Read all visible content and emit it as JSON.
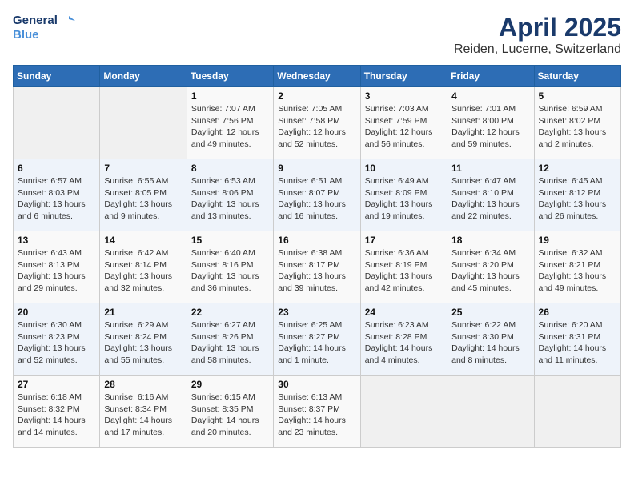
{
  "header": {
    "logo_line1": "General",
    "logo_line2": "Blue",
    "title": "April 2025",
    "subtitle": "Reiden, Lucerne, Switzerland"
  },
  "weekdays": [
    "Sunday",
    "Monday",
    "Tuesday",
    "Wednesday",
    "Thursday",
    "Friday",
    "Saturday"
  ],
  "weeks": [
    [
      {
        "day": "",
        "detail": ""
      },
      {
        "day": "",
        "detail": ""
      },
      {
        "day": "1",
        "detail": "Sunrise: 7:07 AM\nSunset: 7:56 PM\nDaylight: 12 hours and 49 minutes."
      },
      {
        "day": "2",
        "detail": "Sunrise: 7:05 AM\nSunset: 7:58 PM\nDaylight: 12 hours and 52 minutes."
      },
      {
        "day": "3",
        "detail": "Sunrise: 7:03 AM\nSunset: 7:59 PM\nDaylight: 12 hours and 56 minutes."
      },
      {
        "day": "4",
        "detail": "Sunrise: 7:01 AM\nSunset: 8:00 PM\nDaylight: 12 hours and 59 minutes."
      },
      {
        "day": "5",
        "detail": "Sunrise: 6:59 AM\nSunset: 8:02 PM\nDaylight: 13 hours and 2 minutes."
      }
    ],
    [
      {
        "day": "6",
        "detail": "Sunrise: 6:57 AM\nSunset: 8:03 PM\nDaylight: 13 hours and 6 minutes."
      },
      {
        "day": "7",
        "detail": "Sunrise: 6:55 AM\nSunset: 8:05 PM\nDaylight: 13 hours and 9 minutes."
      },
      {
        "day": "8",
        "detail": "Sunrise: 6:53 AM\nSunset: 8:06 PM\nDaylight: 13 hours and 13 minutes."
      },
      {
        "day": "9",
        "detail": "Sunrise: 6:51 AM\nSunset: 8:07 PM\nDaylight: 13 hours and 16 minutes."
      },
      {
        "day": "10",
        "detail": "Sunrise: 6:49 AM\nSunset: 8:09 PM\nDaylight: 13 hours and 19 minutes."
      },
      {
        "day": "11",
        "detail": "Sunrise: 6:47 AM\nSunset: 8:10 PM\nDaylight: 13 hours and 22 minutes."
      },
      {
        "day": "12",
        "detail": "Sunrise: 6:45 AM\nSunset: 8:12 PM\nDaylight: 13 hours and 26 minutes."
      }
    ],
    [
      {
        "day": "13",
        "detail": "Sunrise: 6:43 AM\nSunset: 8:13 PM\nDaylight: 13 hours and 29 minutes."
      },
      {
        "day": "14",
        "detail": "Sunrise: 6:42 AM\nSunset: 8:14 PM\nDaylight: 13 hours and 32 minutes."
      },
      {
        "day": "15",
        "detail": "Sunrise: 6:40 AM\nSunset: 8:16 PM\nDaylight: 13 hours and 36 minutes."
      },
      {
        "day": "16",
        "detail": "Sunrise: 6:38 AM\nSunset: 8:17 PM\nDaylight: 13 hours and 39 minutes."
      },
      {
        "day": "17",
        "detail": "Sunrise: 6:36 AM\nSunset: 8:19 PM\nDaylight: 13 hours and 42 minutes."
      },
      {
        "day": "18",
        "detail": "Sunrise: 6:34 AM\nSunset: 8:20 PM\nDaylight: 13 hours and 45 minutes."
      },
      {
        "day": "19",
        "detail": "Sunrise: 6:32 AM\nSunset: 8:21 PM\nDaylight: 13 hours and 49 minutes."
      }
    ],
    [
      {
        "day": "20",
        "detail": "Sunrise: 6:30 AM\nSunset: 8:23 PM\nDaylight: 13 hours and 52 minutes."
      },
      {
        "day": "21",
        "detail": "Sunrise: 6:29 AM\nSunset: 8:24 PM\nDaylight: 13 hours and 55 minutes."
      },
      {
        "day": "22",
        "detail": "Sunrise: 6:27 AM\nSunset: 8:26 PM\nDaylight: 13 hours and 58 minutes."
      },
      {
        "day": "23",
        "detail": "Sunrise: 6:25 AM\nSunset: 8:27 PM\nDaylight: 14 hours and 1 minute."
      },
      {
        "day": "24",
        "detail": "Sunrise: 6:23 AM\nSunset: 8:28 PM\nDaylight: 14 hours and 4 minutes."
      },
      {
        "day": "25",
        "detail": "Sunrise: 6:22 AM\nSunset: 8:30 PM\nDaylight: 14 hours and 8 minutes."
      },
      {
        "day": "26",
        "detail": "Sunrise: 6:20 AM\nSunset: 8:31 PM\nDaylight: 14 hours and 11 minutes."
      }
    ],
    [
      {
        "day": "27",
        "detail": "Sunrise: 6:18 AM\nSunset: 8:32 PM\nDaylight: 14 hours and 14 minutes."
      },
      {
        "day": "28",
        "detail": "Sunrise: 6:16 AM\nSunset: 8:34 PM\nDaylight: 14 hours and 17 minutes."
      },
      {
        "day": "29",
        "detail": "Sunrise: 6:15 AM\nSunset: 8:35 PM\nDaylight: 14 hours and 20 minutes."
      },
      {
        "day": "30",
        "detail": "Sunrise: 6:13 AM\nSunset: 8:37 PM\nDaylight: 14 hours and 23 minutes."
      },
      {
        "day": "",
        "detail": ""
      },
      {
        "day": "",
        "detail": ""
      },
      {
        "day": "",
        "detail": ""
      }
    ]
  ]
}
